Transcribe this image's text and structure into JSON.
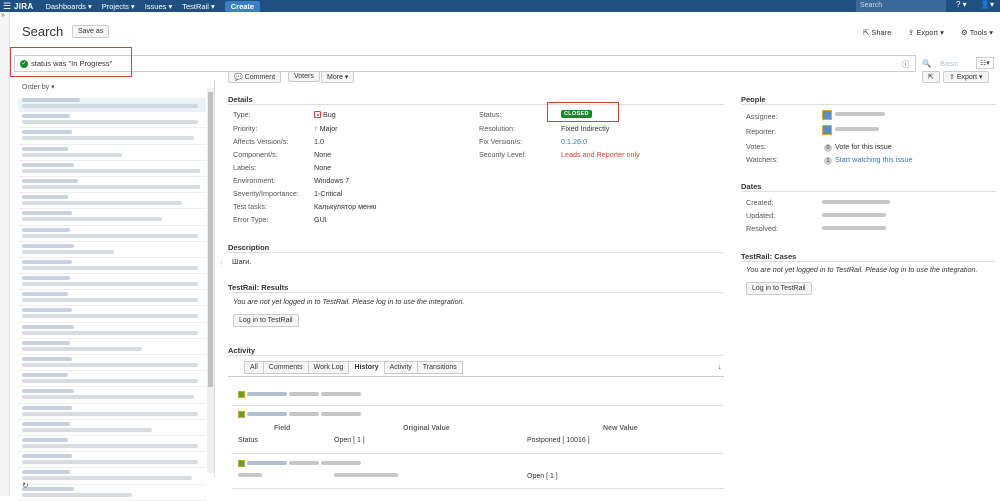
{
  "topbar": {
    "logo": "JIRA",
    "nav": [
      "Dashboards ▾",
      "Projects ▾",
      "Issues ▾",
      "TestRail ▾"
    ],
    "create": "Create",
    "search_placeholder": "Search",
    "help": "? ▾",
    "user": "▾"
  },
  "page": {
    "title": "Search",
    "save_as": "Save as",
    "share": "Share",
    "export": "Export ▾",
    "tools": "Tools ▾"
  },
  "query": {
    "jql": "status was \"In Progress\"",
    "basic": "Basic"
  },
  "list": {
    "order_by": "Order by ▾"
  },
  "toolbar": {
    "comment": "Comment",
    "voters": "Voters",
    "more": "More ▾",
    "export": "Export ▾"
  },
  "details": {
    "heading": "Details",
    "left": [
      {
        "label": "Type:",
        "value": "Bug"
      },
      {
        "label": "Priority:",
        "value": "Major"
      },
      {
        "label": "Affects Version/s:",
        "value": "1.0"
      },
      {
        "label": "Component/s:",
        "value": "None"
      },
      {
        "label": "Labels:",
        "value": "None"
      },
      {
        "label": "Environment:",
        "value": "Windows 7"
      },
      {
        "label": "Severity/Importance:",
        "value": "1-Critical"
      },
      {
        "label": "Test tasks:",
        "value": "Калькулятор меню"
      },
      {
        "label": "Error Type:",
        "value": "GUI"
      }
    ],
    "right": [
      {
        "label": "Status:",
        "value": "CLOSED"
      },
      {
        "label": "Resolution:",
        "value": "Fixed Indirectly"
      },
      {
        "label": "Fix Version/s:",
        "value": "0.1.26.0"
      },
      {
        "label": "Security Level:",
        "value": "Leads and Reporter only"
      }
    ]
  },
  "description": {
    "heading": "Description",
    "text": "Шаги."
  },
  "testrail_results": {
    "heading": "TestRail: Results",
    "message": "You are not yet logged in to TestRail. Please log in to use the integration.",
    "button": "Log in to TestRail"
  },
  "activity": {
    "heading": "Activity",
    "tabs": [
      "All",
      "Comments",
      "Work Log",
      "History",
      "Activity",
      "Transitions"
    ],
    "active_tab": "History",
    "change_table": {
      "headers": [
        "Field",
        "Original Value",
        "New Value"
      ],
      "rows": [
        {
          "field": "Status",
          "original": "Open [ 1 ]",
          "new": "Postponed [ 10016 ]"
        }
      ]
    },
    "second_change": {
      "new": "Open [ 1 ]"
    }
  },
  "people": {
    "heading": "People",
    "assignee_label": "Assignee:",
    "reporter_label": "Reporter:",
    "votes_label": "Votes:",
    "votes_count": "0",
    "votes_link": "Vote for this issue",
    "watchers_label": "Watchers:",
    "watchers_count": "1",
    "watchers_link": "Start watching this issue"
  },
  "dates": {
    "heading": "Dates",
    "created_label": "Created:",
    "updated_label": "Updated:",
    "resolved_label": "Resolved:"
  },
  "testrail_cases": {
    "heading": "TestRail: Cases",
    "message": "You are not yet logged in to TestRail. Please log in to use the integration.",
    "button": "Log in to TestRail"
  },
  "colors": {
    "header_bg": "#205081",
    "closed_badge": "#14892c",
    "highlight_box": "#d04437",
    "link": "#3b73af"
  }
}
